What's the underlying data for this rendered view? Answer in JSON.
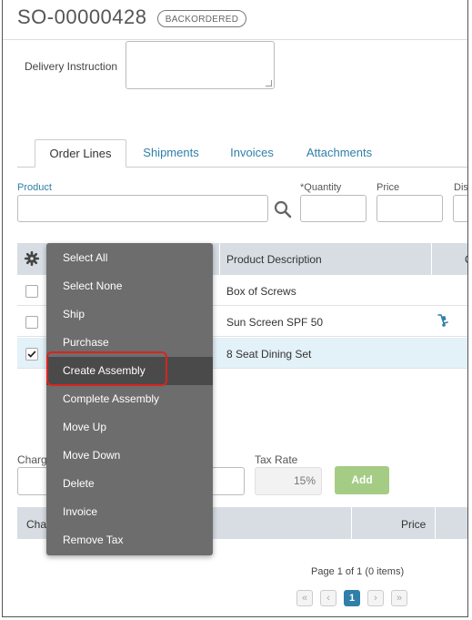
{
  "header": {
    "order_number": "SO-00000428",
    "status_badge": "BACKORDERED"
  },
  "delivery": {
    "label": "Delivery Instruction",
    "value": ""
  },
  "tabs": [
    {
      "label": "Order Lines",
      "active": true
    },
    {
      "label": "Shipments",
      "active": false
    },
    {
      "label": "Invoices",
      "active": false
    },
    {
      "label": "Attachments",
      "active": false
    }
  ],
  "order_form": {
    "product_label": "Product",
    "quantity_label": "*Quantity",
    "price_label": "Price",
    "discount_label": "Dis"
  },
  "table": {
    "columns": [
      "Product Description",
      "C"
    ],
    "rows": [
      {
        "description": "Box of Screws",
        "checked": false
      },
      {
        "description": "Sun Screen SPF 50",
        "checked": false
      },
      {
        "description": "8 Seat Dining Set",
        "checked": true
      }
    ]
  },
  "context_menu": {
    "items": [
      "Select All",
      "Select None",
      "Ship",
      "Purchase",
      "Create Assembly",
      "Complete Assembly",
      "Move Up",
      "Move Down",
      "Delete",
      "Invoice",
      "Remove Tax"
    ],
    "highlighted": "Create Assembly"
  },
  "charges": {
    "charge_label": "Charg",
    "tax_rate_label": "Tax Rate",
    "tax_rate_value": "15%",
    "add_button": "Add",
    "table_col_charge": "Cha",
    "table_col_price": "Price"
  },
  "pager": {
    "summary": "Page 1 of 1 (0 items)",
    "current_page": "1",
    "first": "«",
    "prev": "‹",
    "next": "›",
    "last": "»"
  },
  "colors": {
    "link": "#2f7fa8",
    "menu_bg": "#6d6d6d",
    "menu_highlight": "#4a4a4a",
    "annotation": "#d8241f",
    "add_button": "#a5cc85",
    "selected_row": "#e3f1f8"
  }
}
